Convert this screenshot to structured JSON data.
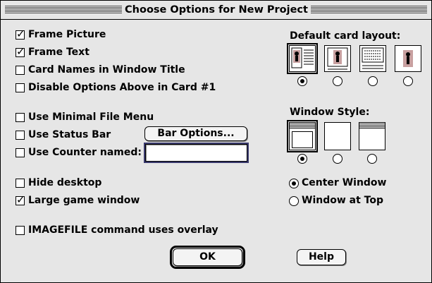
{
  "dialog": {
    "title": "Choose Options for New Project"
  },
  "options": {
    "frame_picture": {
      "label": "Frame Picture",
      "checked": true
    },
    "frame_text": {
      "label": "Frame Text",
      "checked": true
    },
    "card_names": {
      "label": "Card Names in Window Title",
      "checked": false
    },
    "disable_options": {
      "label": "Disable Options Above in Card #1",
      "checked": false
    },
    "minimal_file_menu": {
      "label": "Use Minimal File Menu",
      "checked": false
    },
    "status_bar": {
      "label": "Use Status Bar",
      "checked": false
    },
    "counter": {
      "label": "Use Counter named:",
      "checked": false,
      "value": ""
    },
    "hide_desktop": {
      "label": "Hide desktop",
      "checked": false
    },
    "large_game_window": {
      "label": "Large game window",
      "checked": true
    },
    "imagefile_overlay": {
      "label": "IMAGEFILE command uses overlay",
      "checked": false
    }
  },
  "buttons": {
    "bar_options": "Bar Options...",
    "ok": "OK",
    "help": "Help"
  },
  "card_layout": {
    "label": "Default card layout:",
    "selected_index": 0,
    "icons": [
      "layout-picture-text-icon",
      "layout-picture-framed-icon",
      "layout-text-only-icon",
      "layout-picture-only-icon"
    ]
  },
  "window_style": {
    "label": "Window Style:",
    "selected_index": 0,
    "icons": [
      "window-titlebar-inner-icon",
      "window-plain-icon",
      "window-titlebar-icon"
    ]
  },
  "window_position": {
    "center": {
      "label": "Center Window",
      "selected": true
    },
    "top": {
      "label": "Window at Top",
      "selected": false
    }
  }
}
